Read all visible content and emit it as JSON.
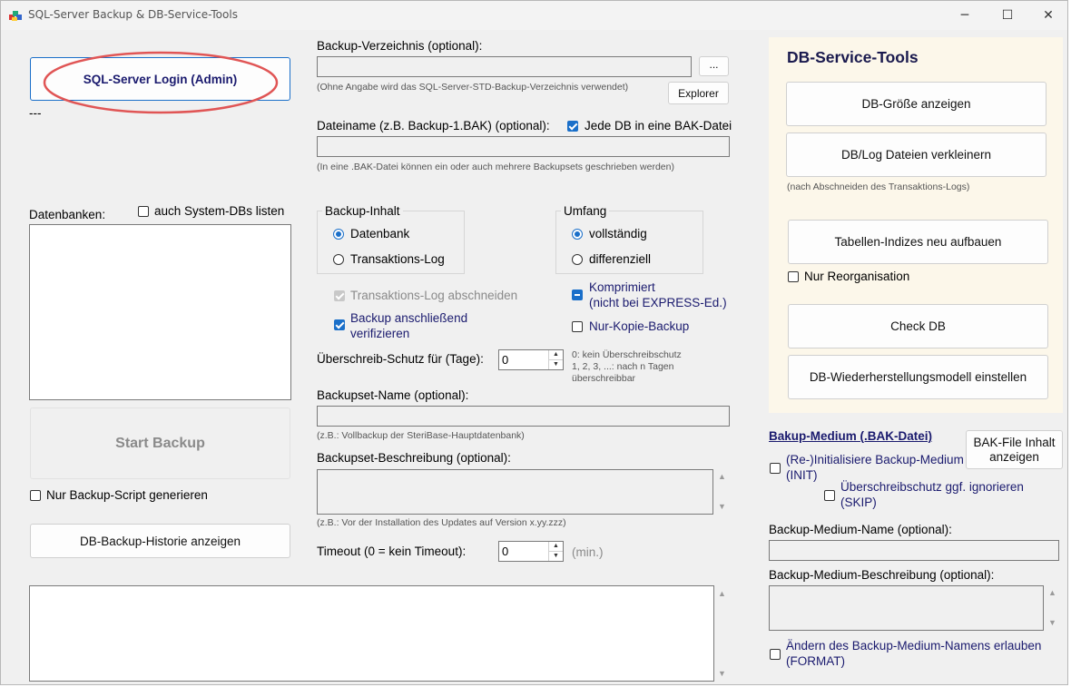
{
  "window": {
    "title": "SQL-Server Backup & DB-Service-Tools",
    "minimize_glyph": "─",
    "maximize_glyph": "☐",
    "close_glyph": "✕"
  },
  "login": {
    "button_label": "SQL-Server Login (Admin)",
    "status": "---"
  },
  "databases": {
    "label": "Datenbanken:",
    "system_dbs_label": "auch System-DBs listen",
    "system_dbs_checked": false
  },
  "backup": {
    "start_label": "Start Backup",
    "script_only_label": "Nur Backup-Script generieren",
    "history_label": "DB-Backup-Historie anzeigen"
  },
  "directory": {
    "label": "Backup-Verzeichnis (optional):",
    "value": "",
    "browse_label": "...",
    "hint": "(Ohne Angabe wird das SQL-Server-STD-Backup-Verzeichnis verwendet)",
    "explorer_label": "Explorer"
  },
  "filename": {
    "label": "Dateiname (z.B. Backup-1.BAK) (optional):",
    "value": "",
    "one_file_label": "Jede DB in eine BAK-Datei",
    "hint": "(In eine .BAK-Datei können ein oder auch mehrere Backupsets geschrieben werden)"
  },
  "content_group": {
    "title": "Backup-Inhalt",
    "opt_database": "Datenbank",
    "opt_log": "Transaktions-Log"
  },
  "scope_group": {
    "title": "Umfang",
    "opt_full": "vollständig",
    "opt_diff": "differenziell"
  },
  "options": {
    "truncate_log": "Transaktions-Log abschneiden",
    "verify_line1": "Backup anschließend",
    "verify_line2": "verifizieren",
    "compress_line1": "Komprimiert",
    "compress_line2": "(nicht bei EXPRESS-Ed.)",
    "copy_only": "Nur-Kopie-Backup"
  },
  "overwrite": {
    "label": "Überschreib-Schutz für (Tage):",
    "value": "0",
    "hint_line1": "0: kein Überschreibschutz",
    "hint_line2": "1, 2, 3, ...: nach n Tagen",
    "hint_line3": "überschreibbar"
  },
  "backupset_name": {
    "label": "Backupset-Name (optional):",
    "value": "",
    "hint": "(z.B.:  Vollbackup der SteriBase-Hauptdatenbank)"
  },
  "backupset_desc": {
    "label": "Backupset-Beschreibung (optional):",
    "value": "",
    "hint": "(z.B.:  Vor der Installation des Updates auf Version x.yy.zzz)"
  },
  "timeout": {
    "label": "Timeout (0 = kein Timeout):",
    "value": "0",
    "unit": "(min.)"
  },
  "service": {
    "title": "DB-Service-Tools",
    "db_size": "DB-Größe anzeigen",
    "shrink": "DB/Log Dateien verkleinern",
    "shrink_hint": "(nach Abschneiden des Transaktions-Logs)",
    "rebuild_index": "Tabellen-Indizes neu aufbauen",
    "reorg_only": "Nur Reorganisation",
    "check_db": "Check DB",
    "recovery_model": "DB-Wiederherstellungsmodell einstellen"
  },
  "medium": {
    "title": "Bakup-Medium (.BAK-Datei)",
    "bak_info_line1": "BAK-File Inhalt",
    "bak_info_line2": "anzeigen",
    "init_line1": "(Re-)Initialisiere Backup-Medium",
    "init_line2": "(INIT)",
    "skip_line1": "Überschreibschutz ggf. ignorieren",
    "skip_line2": "(SKIP)",
    "name_label": "Backup-Medium-Name (optional):",
    "name_value": "",
    "desc_label": "Backup-Medium-Beschreibung (optional):",
    "desc_value": "",
    "format_line1": "Ändern des Backup-Medium-Namens erlauben",
    "format_line2": "(FORMAT)"
  },
  "colors": {
    "accent": "#1a6fc9",
    "annotation": "#e05555",
    "panel": "#fcf7ea",
    "navy": "#1a1a6e"
  }
}
